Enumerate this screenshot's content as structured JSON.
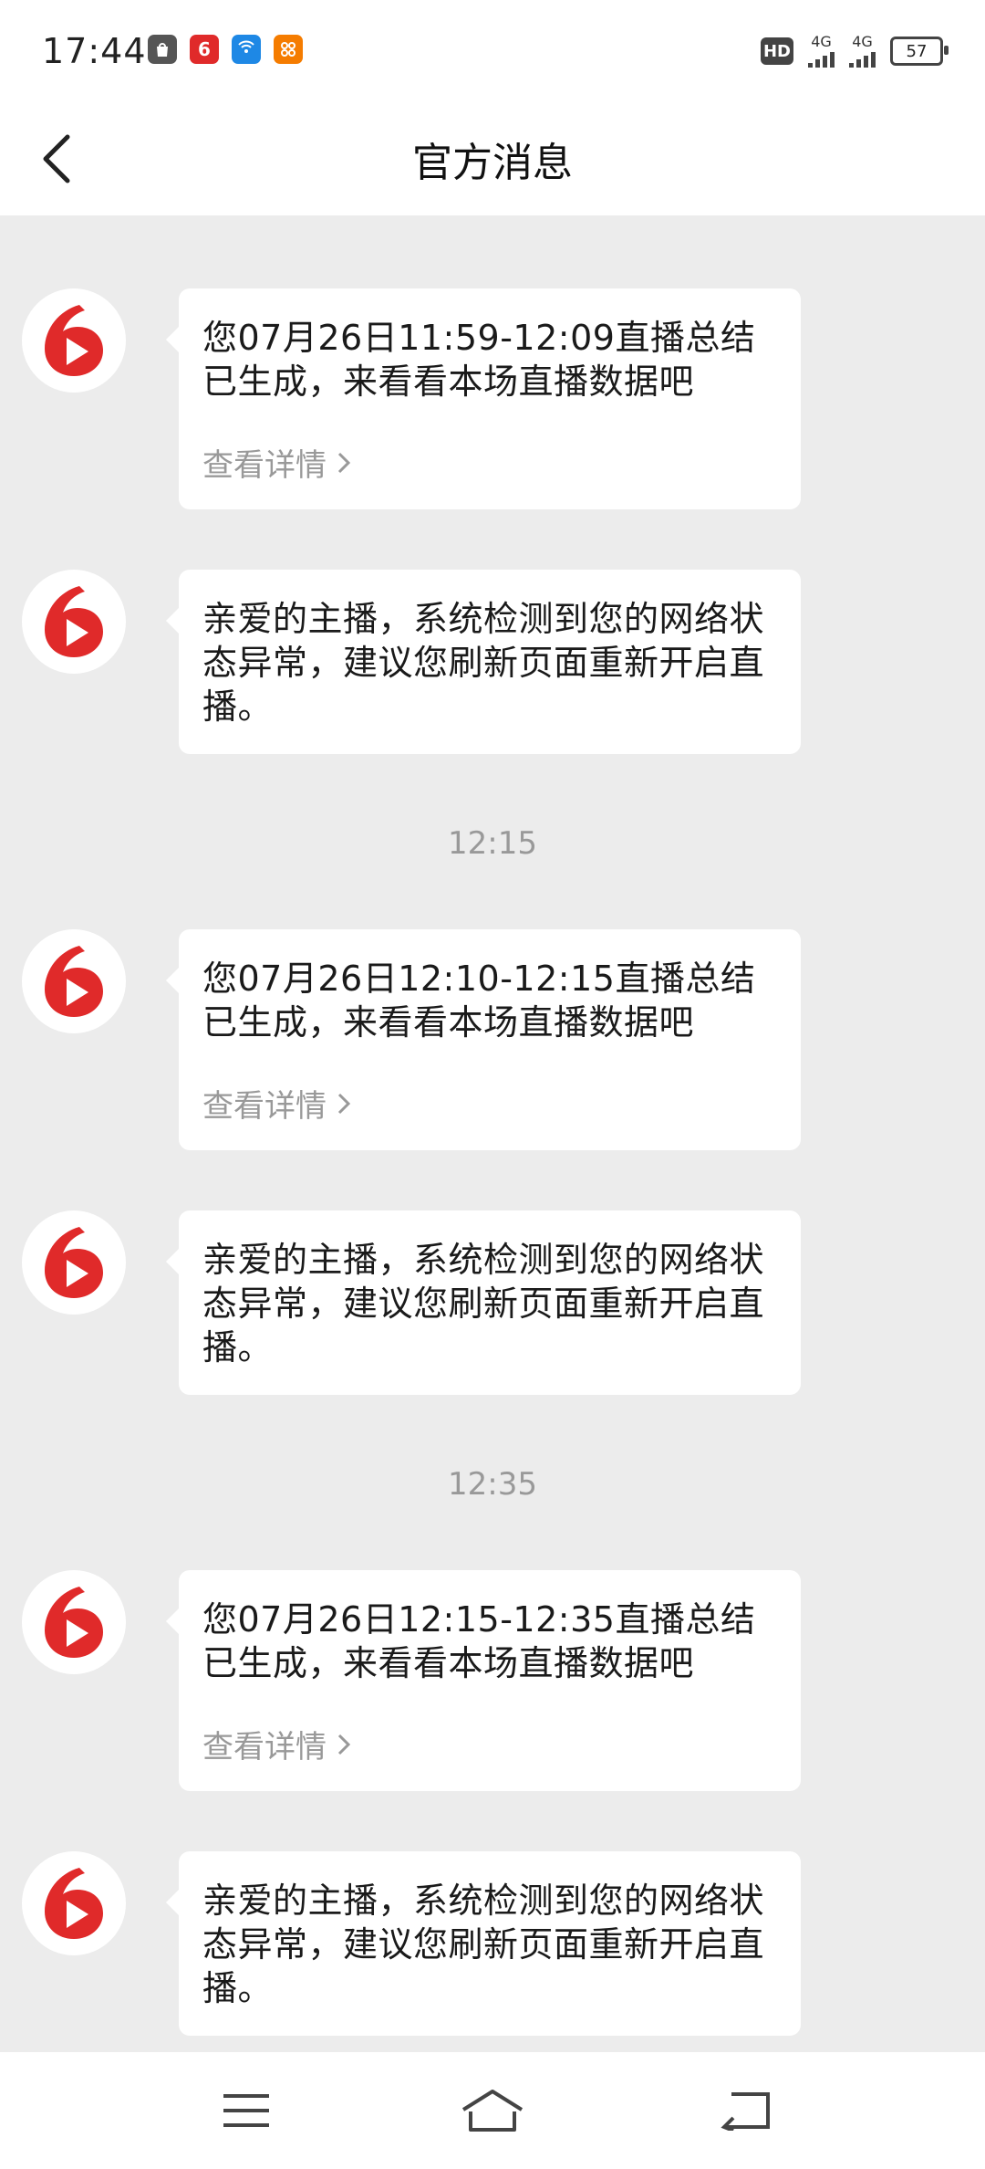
{
  "status_bar": {
    "time": "17:44",
    "network_1": "4G",
    "network_2": "4G",
    "hd_label": "HD",
    "battery": "57"
  },
  "header": {
    "title": "官方消息",
    "back_icon": "back-arrow-icon"
  },
  "messages": [
    {
      "type": "summary",
      "text": "您07月26日11:59-12:09直播总结已生成，来看看本场直播数据吧",
      "link": "查看详情"
    },
    {
      "type": "notice",
      "text": "亲爱的主播，系统检测到您的网络状态异常，建议您刷新页面重新开启直播。"
    },
    {
      "type": "time",
      "text": "12:15"
    },
    {
      "type": "summary",
      "text": "您07月26日12:10-12:15直播总结已生成，来看看本场直播数据吧",
      "link": "查看详情"
    },
    {
      "type": "notice",
      "text": "亲爱的主播，系统检测到您的网络状态异常，建议您刷新页面重新开启直播。"
    },
    {
      "type": "time",
      "text": "12:35"
    },
    {
      "type": "summary",
      "text": "您07月26日12:15-12:35直播总结已生成，来看看本场直播数据吧",
      "link": "查看详情"
    },
    {
      "type": "notice",
      "text": "亲爱的主播，系统检测到您的网络状态异常，建议您刷新页面重新开启直播。"
    }
  ],
  "colors": {
    "brand_red": "#e02a2a",
    "background": "#ececec"
  },
  "nav": {
    "menu_icon": "menu-icon",
    "home_icon": "home-icon",
    "back_icon": "back-icon"
  }
}
